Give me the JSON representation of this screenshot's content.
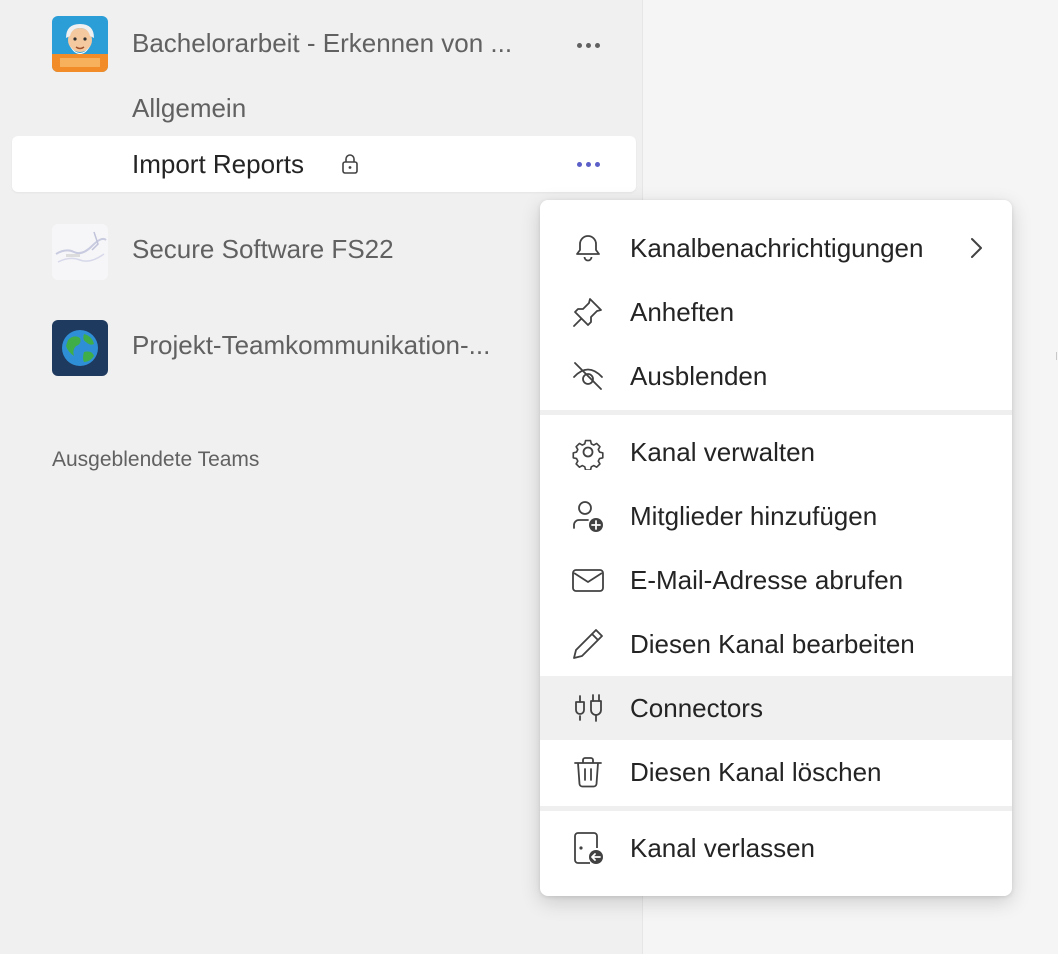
{
  "sidebar": {
    "teams": [
      {
        "name": "Bachelorarbeit - Erkennen von ...",
        "avatar": "illustrated-character-avatar",
        "channels": [
          {
            "name": "Allgemein",
            "private": false,
            "selected": false
          },
          {
            "name": "Import Reports",
            "private": true,
            "selected": true
          }
        ]
      },
      {
        "name": "Secure Software FS22",
        "avatar": "sketch-map-avatar"
      },
      {
        "name": "Projekt-Teamkommunikation-...",
        "avatar": "globe-avatar"
      }
    ],
    "hidden_teams_label": "Ausgeblendete Teams"
  },
  "context_menu": {
    "sections": [
      {
        "items": [
          {
            "label": "Kanalbenachrichtigungen",
            "icon": "bell-icon",
            "submenu": true
          },
          {
            "label": "Anheften",
            "icon": "pin-icon"
          },
          {
            "label": "Ausblenden",
            "icon": "eye-off-icon"
          }
        ]
      },
      {
        "items": [
          {
            "label": "Kanal verwalten",
            "icon": "gear-icon"
          },
          {
            "label": "Mitglieder hinzufügen",
            "icon": "person-add-icon"
          },
          {
            "label": "E-Mail-Adresse abrufen",
            "icon": "mail-icon"
          },
          {
            "label": "Diesen Kanal bearbeiten",
            "icon": "pencil-icon"
          },
          {
            "label": "Connectors",
            "icon": "plug-icon",
            "hovered": true
          },
          {
            "label": "Diesen Kanal löschen",
            "icon": "trash-icon"
          }
        ]
      },
      {
        "items": [
          {
            "label": "Kanal verlassen",
            "icon": "leave-channel-icon"
          }
        ]
      }
    ]
  },
  "colors": {
    "accent": "#5b5fc7",
    "sidebar_bg": "#f0f0f0",
    "selected_bg": "#ffffff",
    "hover_bg": "#f0f0f0"
  }
}
